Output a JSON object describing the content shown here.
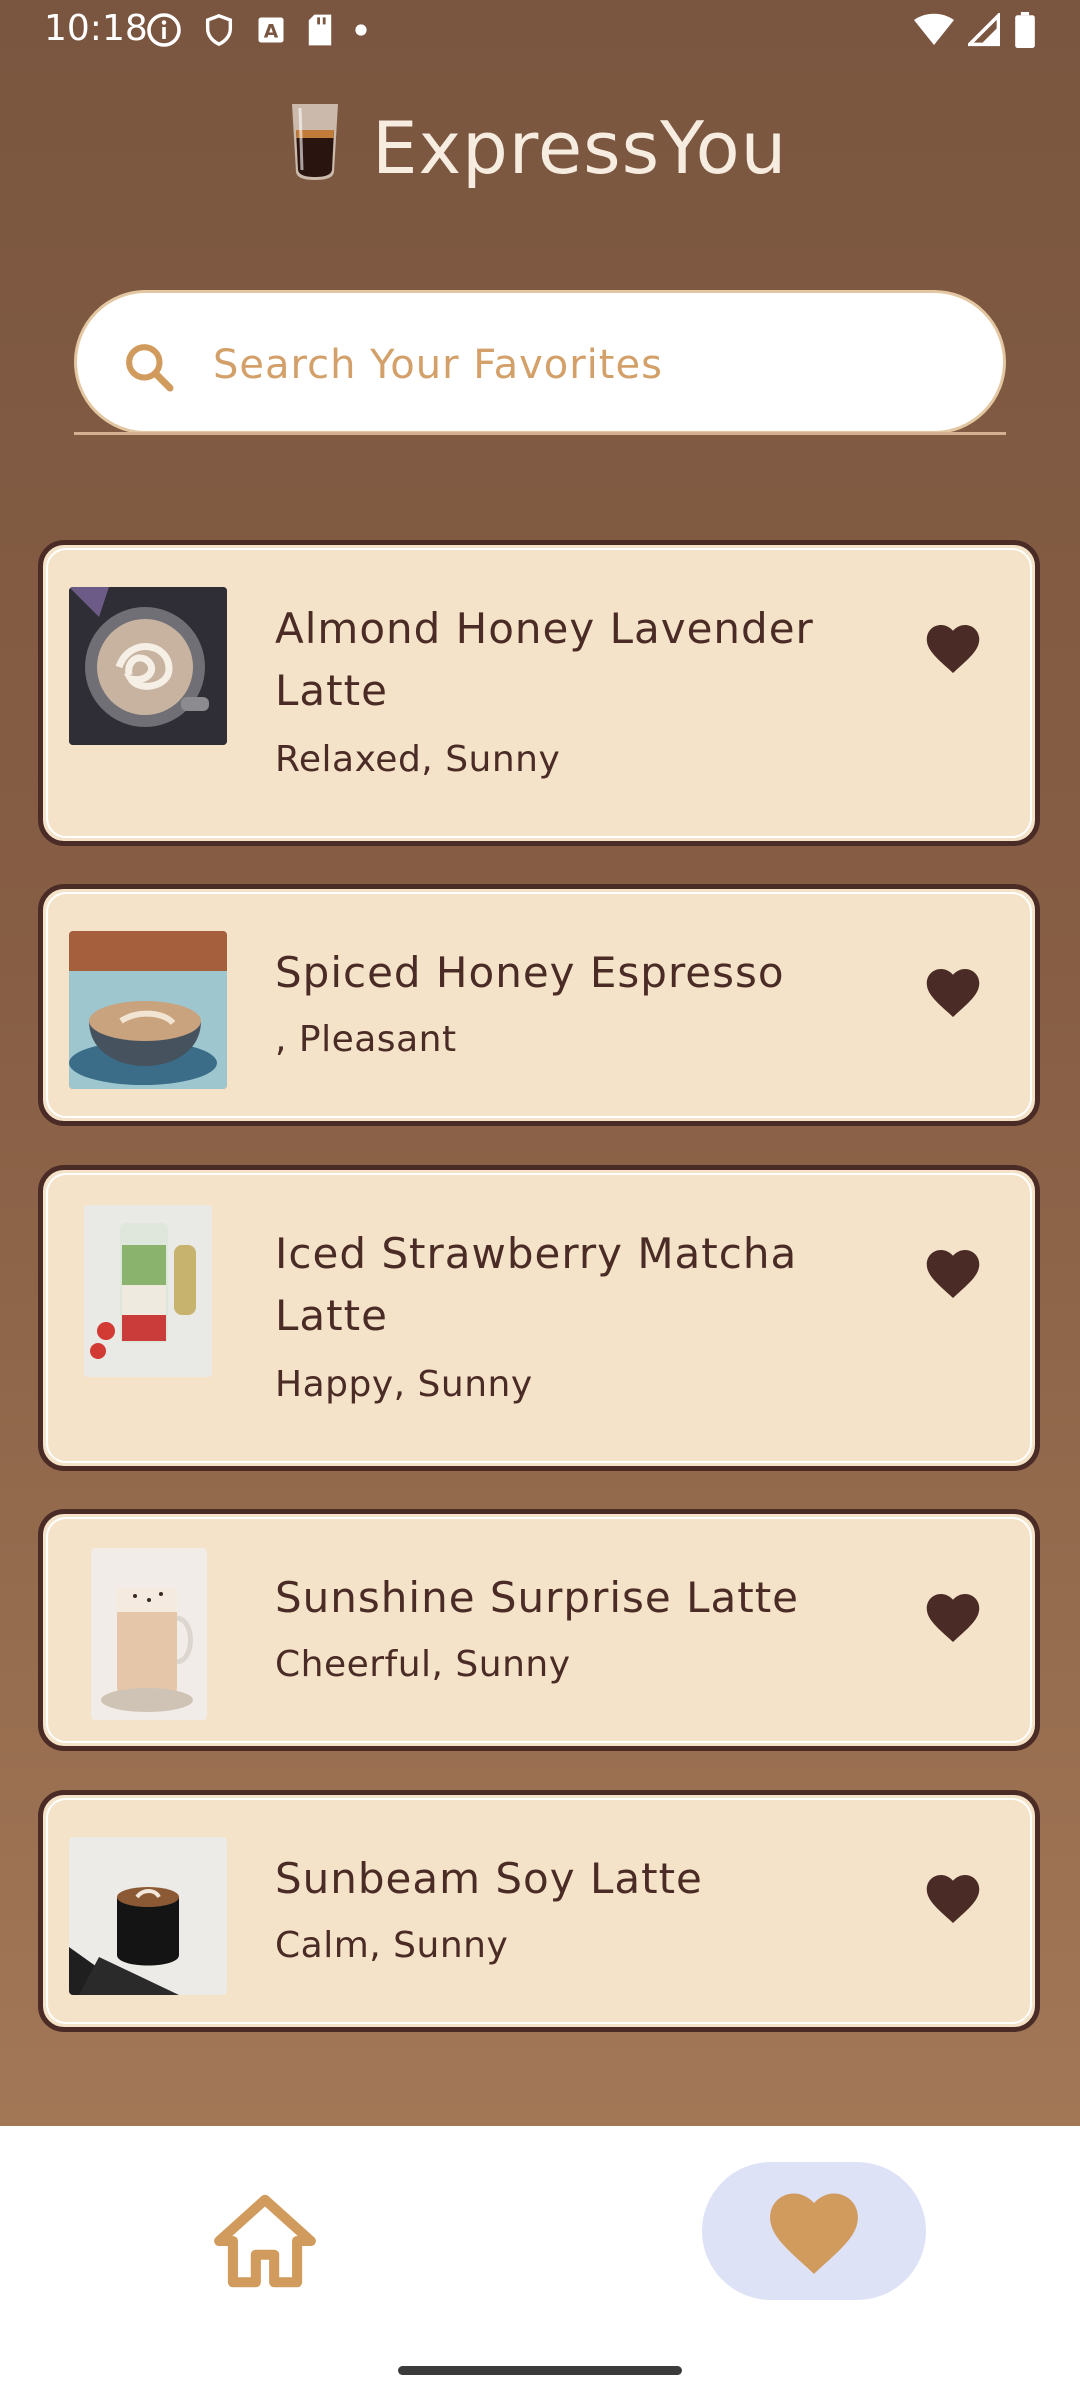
{
  "status_bar": {
    "time": "10:18",
    "left_icons": [
      "info-icon",
      "shield-icon",
      "a-badge-icon",
      "sd-card-icon",
      "dot-icon"
    ],
    "right_icons": [
      "wifi-icon",
      "signal-icon",
      "battery-icon"
    ]
  },
  "header": {
    "app_title": "ExpressYou",
    "logo_icon": "coffee-glass-icon"
  },
  "search": {
    "placeholder": "Search Your Favorites",
    "value": ""
  },
  "favorites": [
    {
      "title": "Almond Honey Lavender Latte",
      "moods": "Relaxed, Sunny",
      "favorited": true
    },
    {
      "title": "Spiced Honey Espresso",
      "moods": ", Pleasant",
      "favorited": true
    },
    {
      "title": "Iced Strawberry Matcha Latte",
      "moods": "Happy, Sunny",
      "favorited": true
    },
    {
      "title": "Sunshine Surprise Latte",
      "moods": "Cheerful, Sunny",
      "favorited": true
    },
    {
      "title": "Sunbeam Soy Latte",
      "moods": "Calm, Sunny",
      "favorited": true
    }
  ],
  "bottom_nav": {
    "items": [
      {
        "icon": "home-icon",
        "selected": false
      },
      {
        "icon": "heart-icon",
        "selected": true
      }
    ]
  },
  "colors": {
    "card_bg": "#f4e3c8",
    "card_border": "#4a2b25",
    "accent": "#d19b5d",
    "nav_selected_bg": "#dde2f6"
  }
}
